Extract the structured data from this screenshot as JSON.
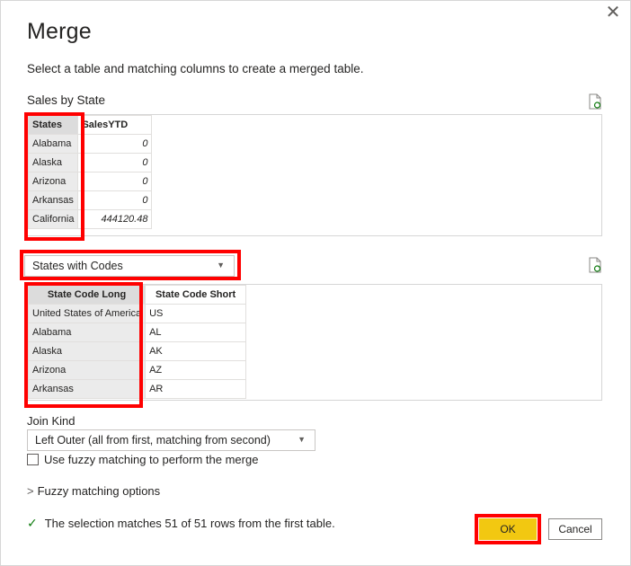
{
  "dialog": {
    "title": "Merge",
    "subtitle": "Select a table and matching columns to create a merged table.",
    "close_glyph": "✕"
  },
  "first_table": {
    "name": "Sales by State",
    "headers": [
      "States",
      "SalesYTD"
    ],
    "rows": [
      [
        "Alabama",
        "0"
      ],
      [
        "Alaska",
        "0"
      ],
      [
        "Arizona",
        "0"
      ],
      [
        "Arkansas",
        "0"
      ],
      [
        "California",
        "444120.48"
      ]
    ]
  },
  "second_table": {
    "selected": "States with Codes",
    "headers": [
      "State Code Long",
      "State Code Short"
    ],
    "rows": [
      [
        "United States of America",
        "US"
      ],
      [
        "Alabama",
        "AL"
      ],
      [
        "Alaska",
        "AK"
      ],
      [
        "Arizona",
        "AZ"
      ],
      [
        "Arkansas",
        "AR"
      ]
    ]
  },
  "join_kind": {
    "label": "Join Kind",
    "selected": "Left Outer (all from first, matching from second)"
  },
  "fuzzy": {
    "checkbox_label": "Use fuzzy matching to perform the merge",
    "checked": false,
    "options_label": "Fuzzy matching options"
  },
  "status": {
    "message": "The selection matches 51 of 51 rows from the first table."
  },
  "buttons": {
    "ok": "OK",
    "cancel": "Cancel"
  },
  "icons": {
    "close": "close-icon",
    "refresh": "refresh-icon",
    "check": "checkmark-icon",
    "caret": "chevron-down-icon",
    "chevron_right": "chevron-right-icon"
  },
  "colors": {
    "ok_button": "#f2c811",
    "highlight": "#ff0000",
    "success": "#107c10",
    "selected_column": "#ebebeb"
  }
}
